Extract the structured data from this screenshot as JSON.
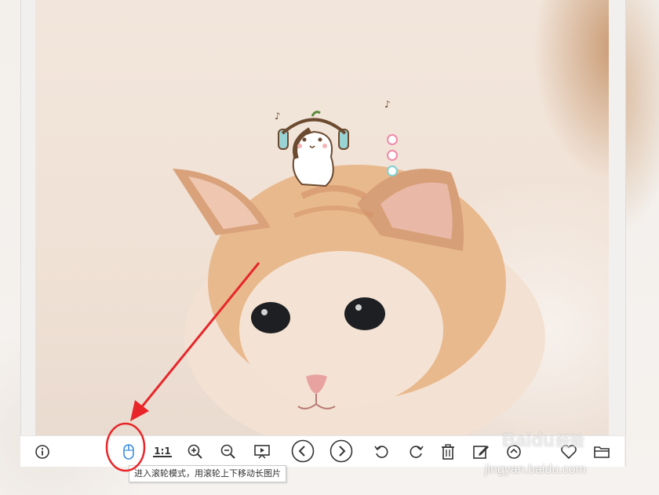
{
  "toolbar": {
    "items": [
      {
        "name": "info-button",
        "icon": "info-icon"
      },
      {
        "name": "scroll-mode-button",
        "icon": "mouse-icon",
        "highlighted": true
      },
      {
        "name": "actual-size-button",
        "label": "1:1"
      },
      {
        "name": "zoom-in-button",
        "icon": "zoom-in-icon"
      },
      {
        "name": "zoom-out-button",
        "icon": "zoom-out-icon"
      },
      {
        "name": "slideshow-button",
        "icon": "slideshow-icon"
      },
      {
        "name": "previous-button",
        "icon": "chevron-left-icon"
      },
      {
        "name": "next-button",
        "icon": "chevron-right-icon"
      },
      {
        "name": "rotate-left-button",
        "icon": "rotate-left-icon"
      },
      {
        "name": "rotate-right-button",
        "icon": "rotate-right-icon"
      },
      {
        "name": "delete-button",
        "icon": "trash-icon"
      },
      {
        "name": "edit-button",
        "icon": "edit-icon"
      },
      {
        "name": "share-button",
        "icon": "share-icon"
      },
      {
        "name": "favorite-button",
        "icon": "heart-icon"
      },
      {
        "name": "folder-button",
        "icon": "folder-icon"
      }
    ]
  },
  "tooltip": {
    "text": "进入滚轮模式，用滚轮上下移动长图片"
  },
  "watermark": {
    "logo": "Baidu",
    "sub": "经验",
    "url": "jingyan.baidu.com"
  },
  "colors": {
    "annotation_red": "#e8262a",
    "accent_blue": "#3d8fe0",
    "toolbar_bg": "#ffffff"
  }
}
